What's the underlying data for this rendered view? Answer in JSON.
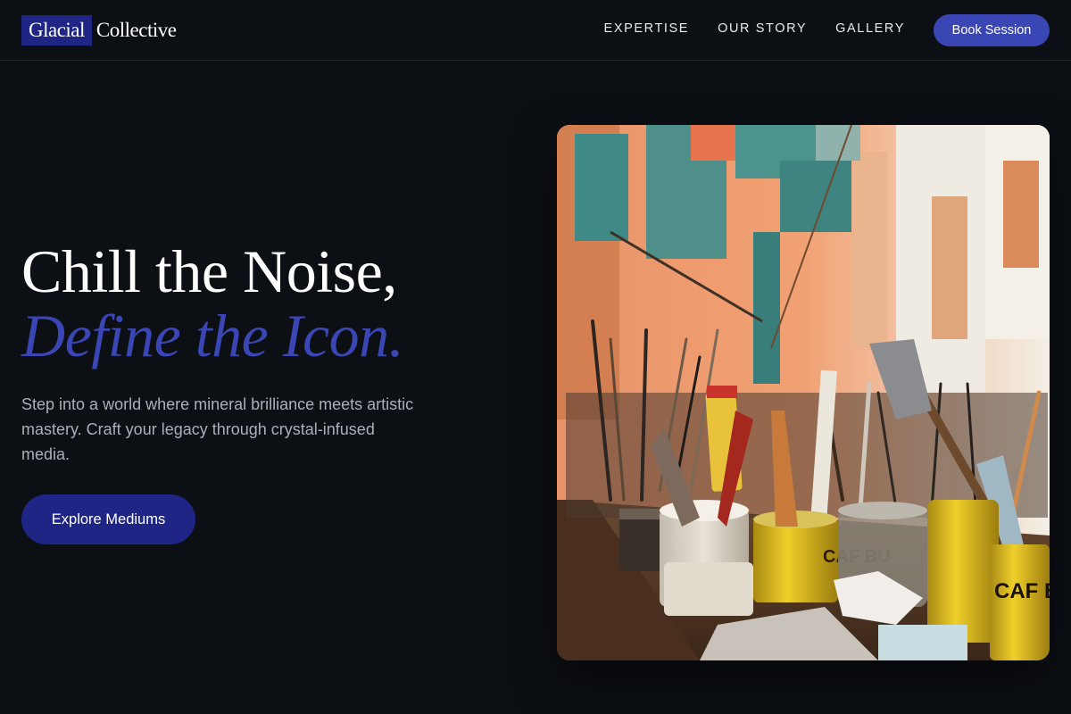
{
  "brand": {
    "mark": "Glacial",
    "word": "Collective"
  },
  "nav": {
    "links": [
      "EXPERTISE",
      "OUR STORY",
      "GALLERY"
    ],
    "cta": "Book Session"
  },
  "hero": {
    "title_line1": "Chill the Noise,",
    "title_line2": "Define the Icon.",
    "description": "Step into a world where mineral brilliance meets artistic mastery. Craft your legacy through crystal-infused media.",
    "button": "Explore Mediums"
  },
  "image": {
    "can_label_1": "CAF BU",
    "can_label_2": "CAF BUST"
  },
  "colors": {
    "background": "#0c0f14",
    "accent": "#3a46b4",
    "brand_navy": "#1e2585",
    "muted_text": "#a9afbb"
  }
}
